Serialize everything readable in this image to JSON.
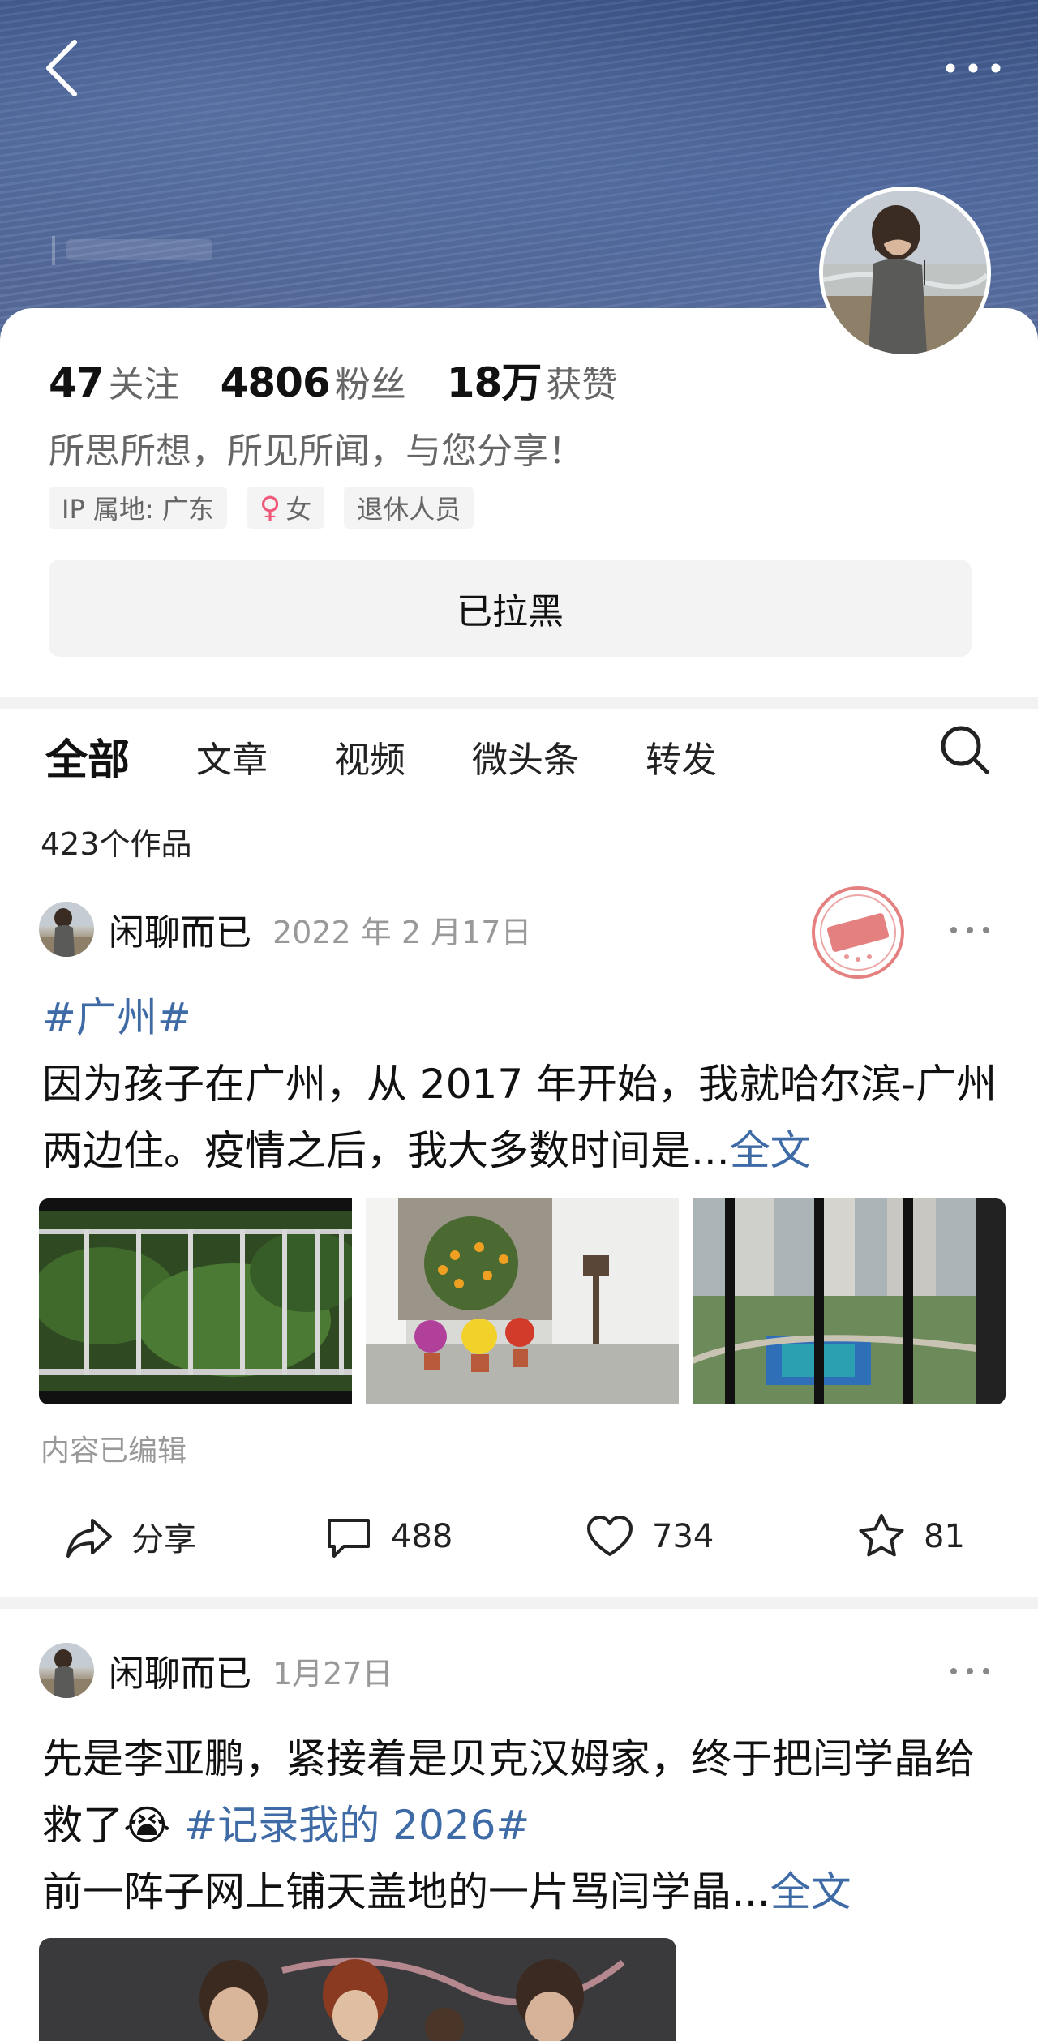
{
  "profile": {
    "stats": [
      {
        "value": "47",
        "label": "关注"
      },
      {
        "value": "4806",
        "label": "粉丝"
      },
      {
        "value": "18万",
        "label": "获赞"
      }
    ],
    "bio": "所思所想，所见所闻，与您分享！",
    "tags": {
      "ip": "IP 属地: 广东",
      "gender_symbol": "♀",
      "gender": "女",
      "occupation": "退休人员"
    },
    "blocked_label": "已拉黑"
  },
  "tabs": [
    "全部",
    "文章",
    "视频",
    "微头条",
    "转发"
  ],
  "works_count": "423个作品",
  "posts": [
    {
      "author": "闲聊而已",
      "date": "2022 年 2 月17日",
      "hashtag": "#广州#",
      "text": "因为孩子在广州，从 2017 年开始，我就哈尔滨-广州两边住。疫情之后，我大多数时间是...",
      "full_label": "全文",
      "edited": "内容已编辑",
      "actions": {
        "share": "分享",
        "comments": "488",
        "likes": "734",
        "favorites": "81"
      }
    },
    {
      "author": "闲聊而已",
      "date": "1月27日",
      "text_1": "先是李亚鹏，紧接着是贝克汉姆家，终于把闫学晶给救了",
      "emoji": "😭",
      "hashtag": "#记录我的 2026#",
      "text_2": "前一阵子网上铺天盖地的一片骂闫学晶...",
      "full_label": "全文"
    }
  ],
  "colors": {
    "link": "#3e6aa6",
    "stamp": "#e06a6a",
    "banner": "#4d6497"
  },
  "icons": [
    "back-arrow-icon",
    "more-dots-icon",
    "search-icon",
    "share-icon",
    "comment-icon",
    "heart-icon",
    "star-icon"
  ]
}
